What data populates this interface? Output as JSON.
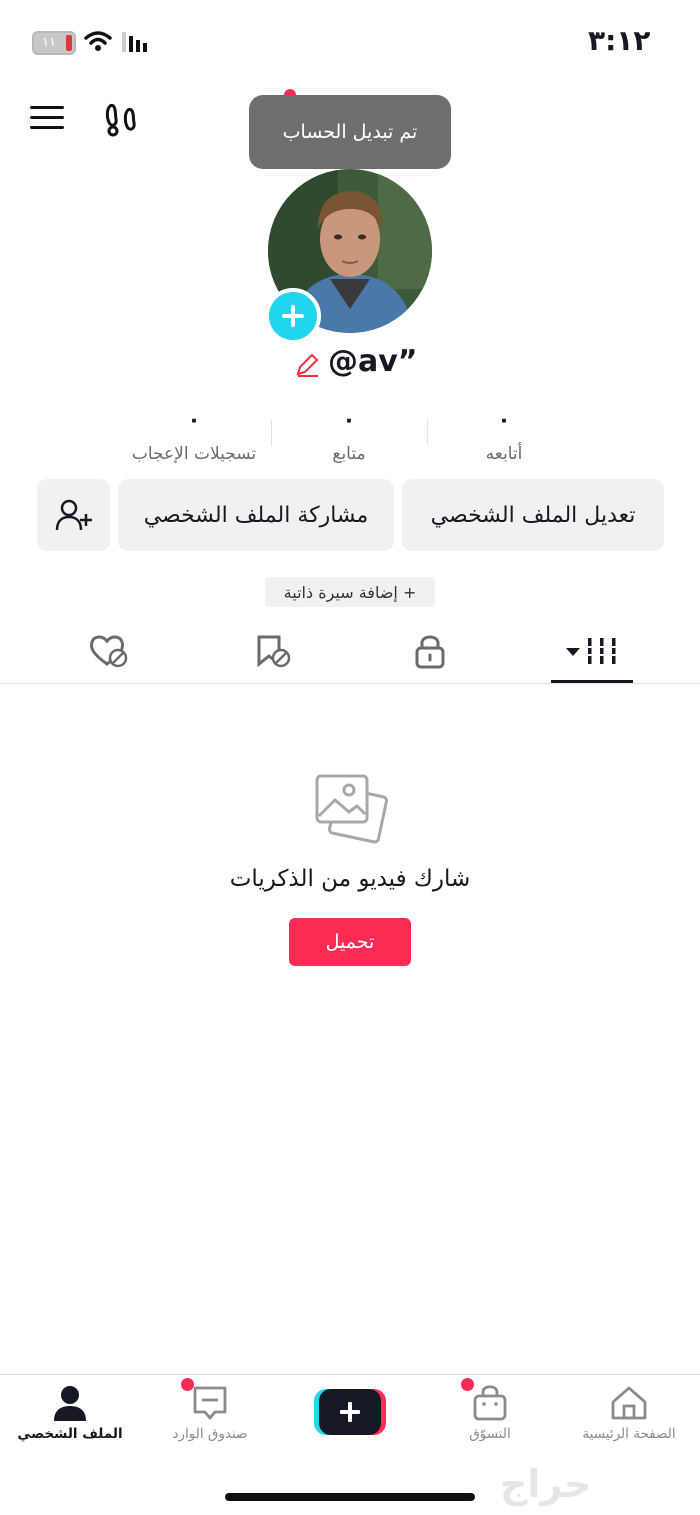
{
  "status_bar": {
    "time": "٣:١٢",
    "battery": "١١"
  },
  "toast": {
    "text": "تم تبديل الحساب"
  },
  "profile": {
    "username": "@av”"
  },
  "stats": [
    {
      "value": "٠",
      "label": "أتابعه"
    },
    {
      "value": "٠",
      "label": "متابع"
    },
    {
      "value": "٠",
      "label": "تسجيلات الإعجاب"
    }
  ],
  "actions": {
    "edit_profile": "تعديل الملف الشخصي",
    "share_profile": "مشاركة الملف الشخصي",
    "add_bio": "+ إضافة سيرة ذاتية"
  },
  "tabs": [
    {
      "icon": "videos-grid-icon",
      "active": true
    },
    {
      "icon": "lock-icon"
    },
    {
      "icon": "saved-hidden-icon"
    },
    {
      "icon": "liked-hidden-icon"
    }
  ],
  "empty_state": {
    "title": "شارك فيديو من الذكريات",
    "upload_label": "تحميل"
  },
  "bottom_nav": {
    "home": "الصفحة الرئيسية",
    "shop": "التسوّق",
    "inbox": "صندوق الوارد",
    "profile": "الملف الشخصي"
  },
  "watermark": "حراج",
  "colors": {
    "accent": "#fe2c55",
    "cyan": "#20d5ec",
    "toast_bg": "#6e6e6e"
  }
}
